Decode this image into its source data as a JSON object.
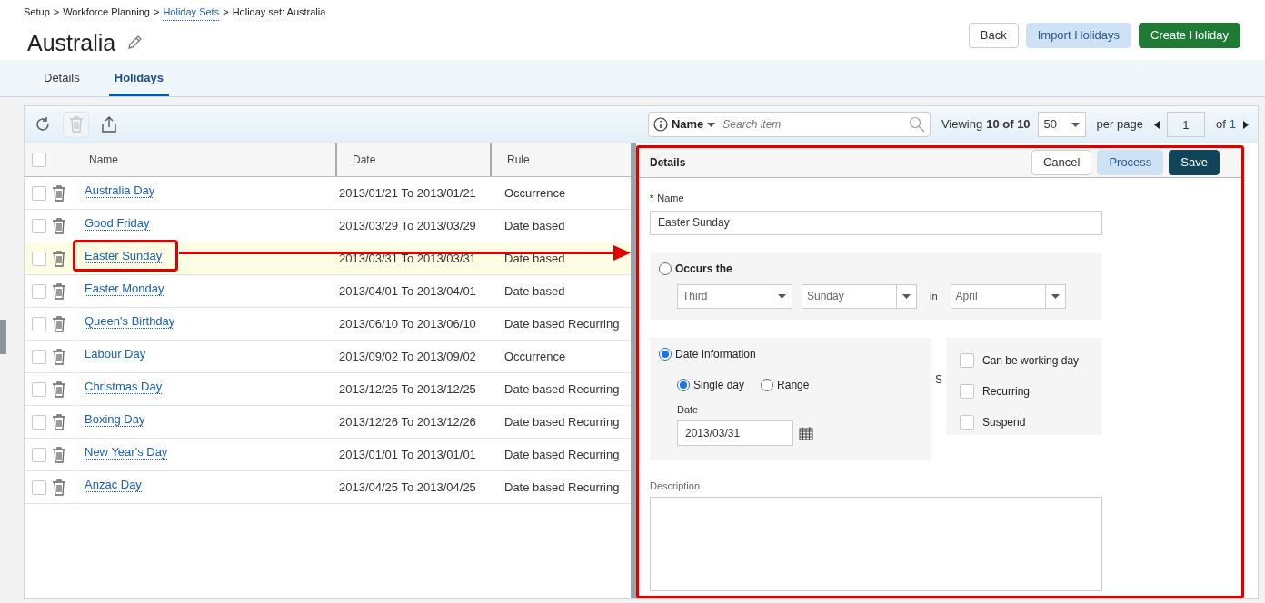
{
  "breadcrumb": {
    "separator": ">",
    "items": [
      {
        "text": "Setup",
        "link": false
      },
      {
        "text": "Workforce Planning",
        "link": false
      },
      {
        "text": "Holiday Sets",
        "link": true
      },
      {
        "text": "Holiday set: Australia",
        "link": false
      }
    ]
  },
  "title": "Australia",
  "header_buttons": [
    {
      "label": "Back",
      "kind": "default"
    },
    {
      "label": "Import Holidays",
      "kind": "secondary"
    },
    {
      "label": "Create Holiday",
      "kind": "primary"
    }
  ],
  "tabs": [
    {
      "label": "Details",
      "selected": false
    },
    {
      "label": "Holidays",
      "selected": true
    }
  ],
  "toolbar": {
    "delete_disabled": true,
    "search": {
      "field": "Name",
      "placeholder": "Search item"
    },
    "viewing_label": "Viewing",
    "viewing_count": "10 of 10",
    "page_size": "50",
    "per_page": "per page",
    "page": "1",
    "of": "of",
    "total_pages": "1"
  },
  "table": {
    "select_all_checked": false,
    "columns": [
      "Name",
      "Date",
      "Rule"
    ],
    "rows": [
      {
        "name": "Australia Day",
        "date": "2013/01/21 To 2013/01/21",
        "rule": "Occurrence",
        "selected": false,
        "checked": false
      },
      {
        "name": "Good Friday",
        "date": "2013/03/29 To 2013/03/29",
        "rule": "Date based",
        "selected": false,
        "checked": false
      },
      {
        "name": "Easter Sunday",
        "date": "2013/03/31 To 2013/03/31",
        "rule": "Date based",
        "selected": true,
        "checked": false
      },
      {
        "name": "Easter Monday",
        "date": "2013/04/01 To 2013/04/01",
        "rule": "Date based",
        "selected": false,
        "checked": false
      },
      {
        "name": "Queen's Birthday",
        "date": "2013/06/10 To 2013/06/10",
        "rule": "Date based Recurring",
        "selected": false,
        "checked": false
      },
      {
        "name": "Labour Day",
        "date": "2013/09/02 To 2013/09/02",
        "rule": "Occurrence",
        "selected": false,
        "checked": false
      },
      {
        "name": "Christmas Day",
        "date": "2013/12/25 To 2013/12/25",
        "rule": "Date based Recurring",
        "selected": false,
        "checked": false
      },
      {
        "name": "Boxing Day",
        "date": "2013/12/26 To 2013/12/26",
        "rule": "Date based Recurring",
        "selected": false,
        "checked": false
      },
      {
        "name": "New Year's Day",
        "date": "2013/01/01 To 2013/01/01",
        "rule": "Date based Recurring",
        "selected": false,
        "checked": false
      },
      {
        "name": "Anzac Day",
        "date": "2013/04/25 To 2013/04/25",
        "rule": "Date based Recurring",
        "selected": false,
        "checked": false
      }
    ]
  },
  "details": {
    "title": "Details",
    "buttons": [
      {
        "label": "Cancel",
        "kind": "default"
      },
      {
        "label": "Process",
        "kind": "secondary"
      },
      {
        "label": "Save",
        "kind": "dark"
      }
    ],
    "name": {
      "required_mark": "*",
      "label": "Name",
      "value": "Easter Sunday"
    },
    "occurs": {
      "label": "Occurs the",
      "selected": false,
      "selects": [
        "Third",
        "Sunday",
        "April"
      ],
      "in_label": "in"
    },
    "date_information": {
      "label": "Date Information",
      "selected": true,
      "modes": [
        {
          "label": "Single day",
          "selected": true
        },
        {
          "label": "Range",
          "selected": false
        }
      ],
      "date_label": "Date",
      "date_value": "2013/03/31"
    },
    "stray_text": "S",
    "options": [
      {
        "label": "Can be working day",
        "checked": false
      },
      {
        "label": "Recurring",
        "checked": false
      },
      {
        "label": "Suspend",
        "checked": false
      }
    ],
    "description": {
      "label": "Description"
    }
  }
}
